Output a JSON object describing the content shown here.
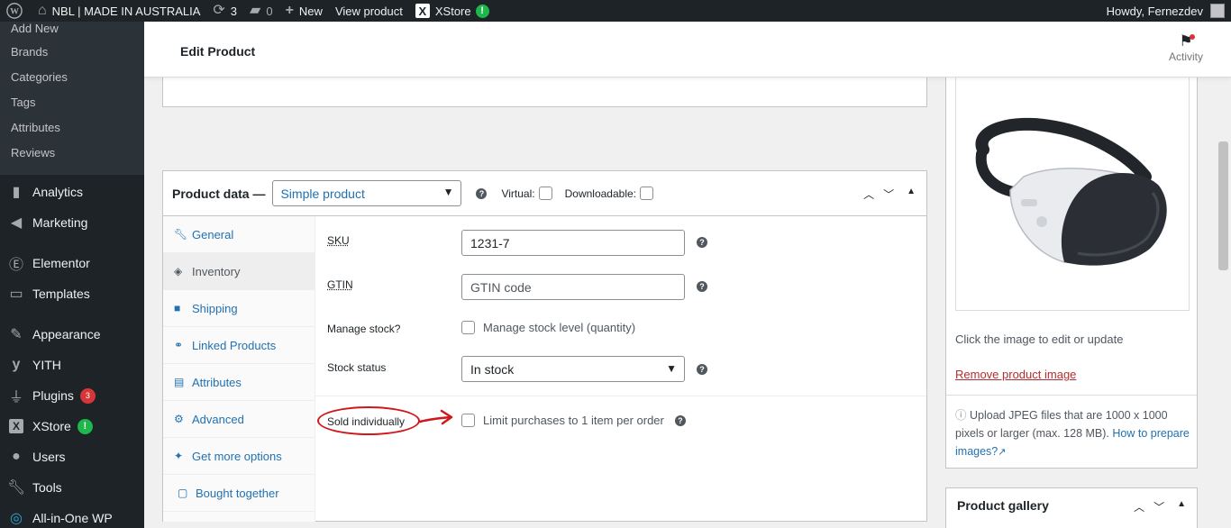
{
  "admin_bar": {
    "site_name": "NBL | MADE IN AUSTRALIA",
    "updates_count": "3",
    "comments_count": "0",
    "new_label": "New",
    "view_product": "View product",
    "xstore_label": "XStore",
    "xstore_badge": "!",
    "howdy": "Howdy, Fernezdev"
  },
  "sidebar": {
    "submenu": [
      "Add New",
      "Brands",
      "Categories",
      "Tags",
      "Attributes",
      "Reviews"
    ],
    "items": [
      {
        "label": "Analytics",
        "icon": "bar-chart-icon"
      },
      {
        "label": "Marketing",
        "icon": "megaphone-icon"
      },
      {
        "label": "Elementor",
        "icon": "elementor-icon"
      },
      {
        "label": "Templates",
        "icon": "folder-icon"
      },
      {
        "label": "Appearance",
        "icon": "paintbrush-icon"
      },
      {
        "label": "YITH",
        "icon": "yith-icon"
      },
      {
        "label": "Plugins",
        "icon": "plug-icon",
        "badge": "3"
      },
      {
        "label": "XStore",
        "icon": "xstore-icon",
        "badge": "!"
      },
      {
        "label": "Users",
        "icon": "users-icon"
      },
      {
        "label": "Tools",
        "icon": "wrench-icon"
      },
      {
        "label": "All-in-One WP",
        "icon": "migration-icon"
      }
    ]
  },
  "header": {
    "title": "Edit Product",
    "activity": "Activity"
  },
  "product_data": {
    "title": "Product data —",
    "type_value": "Simple product",
    "virtual_label": "Virtual:",
    "downloadable_label": "Downloadable:",
    "help_glyph": "?",
    "tabs": [
      "General",
      "Inventory",
      "Shipping",
      "Linked Products",
      "Attributes",
      "Advanced",
      "Get more options",
      "Bought together"
    ],
    "active_tab": "Inventory",
    "fields": {
      "sku_label": "SKU",
      "sku_value": "1231-7",
      "gtin_label": "GTIN",
      "gtin_placeholder": "GTIN code",
      "manage_stock_label": "Manage stock?",
      "manage_stock_checkbox": "Manage stock level (quantity)",
      "stock_status_label": "Stock status",
      "stock_status_value": "In stock",
      "sold_individually_label": "Sold individually",
      "sold_individually_checkbox": "Limit purchases to 1 item per order"
    }
  },
  "product_image": {
    "caption": "Click the image to edit or update",
    "remove_link": "Remove product image",
    "upload_note": "Upload JPEG files that are 1000 x 1000 pixels or larger (max. 128 MB).",
    "upload_link": "How to prepare images?"
  },
  "product_gallery": {
    "title": "Product gallery"
  },
  "colors": {
    "admin_dark": "#1d2327",
    "link_blue": "#2271b1",
    "remove_red": "#b32d2e",
    "annotation_red": "#d0181b"
  }
}
